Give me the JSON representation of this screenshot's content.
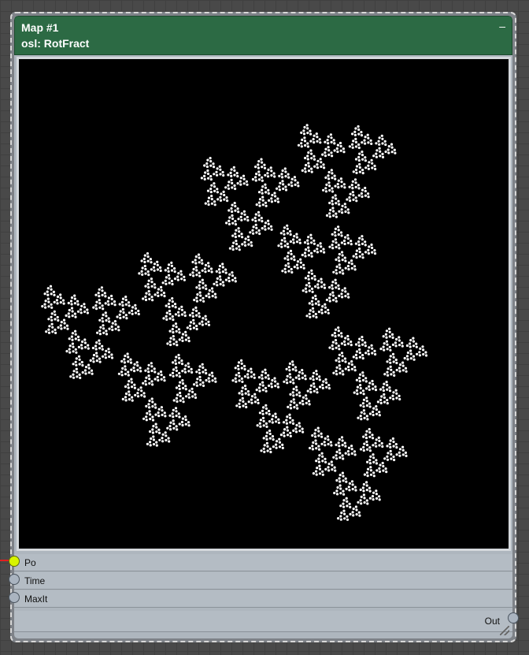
{
  "node": {
    "title": "Map #1",
    "subtitle": "osl: RotFract",
    "minimize_label": "–",
    "preview_label": "fractal-preview"
  },
  "ports": {
    "inputs": [
      {
        "label": "Po",
        "connected": true
      },
      {
        "label": "Time",
        "connected": false
      },
      {
        "label": "MaxIt",
        "connected": false
      }
    ],
    "output": {
      "label": "Out"
    }
  },
  "colors": {
    "header": "#2c6a44",
    "active_socket": "#d8f400",
    "wire": "#e02020",
    "body": "#aeb6be",
    "fractal": "#ffffff",
    "preview_bg": "#000000"
  }
}
